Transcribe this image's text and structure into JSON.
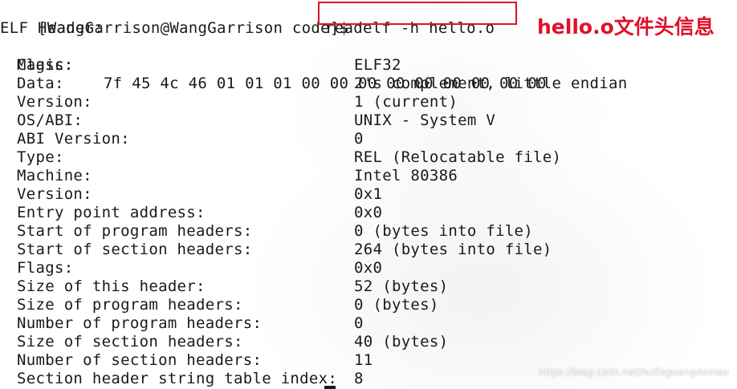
{
  "terminal": {
    "prompt": "[WangGarrison@WangGarrison code]$",
    "command": "readelf -h hello.o",
    "header_title": "ELF Header:",
    "magic": {
      "label": "Magic:",
      "value": "7f 45 4c 46 01 01 01 00 00 00 00 00 00 00 00 00"
    },
    "fields": [
      {
        "label": "Class:",
        "value": "ELF32"
      },
      {
        "label": "Data:",
        "value": "2's complement, little endian"
      },
      {
        "label": "Version:",
        "value": "1 (current)"
      },
      {
        "label": "OS/ABI:",
        "value": "UNIX - System V"
      },
      {
        "label": "ABI Version:",
        "value": "0"
      },
      {
        "label": "Type:",
        "value": "REL (Relocatable file)"
      },
      {
        "label": "Machine:",
        "value": "Intel 80386"
      },
      {
        "label": "Version:",
        "value": "0x1"
      },
      {
        "label": "Entry point address:",
        "value": "0x0"
      },
      {
        "label": "Start of program headers:",
        "value": "0 (bytes into file)"
      },
      {
        "label": "Start of section headers:",
        "value": "264 (bytes into file)"
      },
      {
        "label": "Flags:",
        "value": "0x0"
      },
      {
        "label": "Size of this header:",
        "value": "52 (bytes)"
      },
      {
        "label": "Size of program headers:",
        "value": "0 (bytes)"
      },
      {
        "label": "Number of program headers:",
        "value": "0"
      },
      {
        "label": "Size of section headers:",
        "value": "40 (bytes)"
      },
      {
        "label": "Number of section headers:",
        "value": "11"
      },
      {
        "label": "Section header string table index:",
        "value": "8"
      }
    ]
  },
  "annotation": {
    "text": "hello.o文件头信息",
    "color": "#e0102a"
  },
  "watermark": "https://blog.csdn.net/huifaguangdemao"
}
